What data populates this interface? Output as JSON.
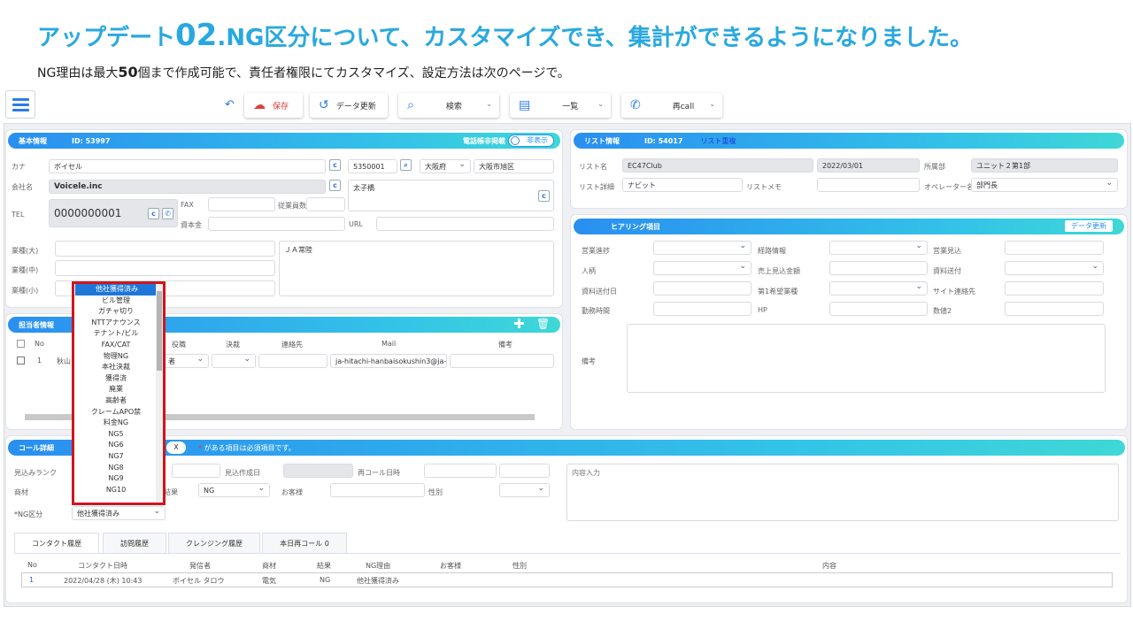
{
  "header": {
    "title_pre": "アップデート",
    "title_num": "02",
    "title_post": ".NG区分について、カスタマイズでき、集計ができるようになりました。",
    "sub_pre": "NG理由は最大",
    "sub_num": "50",
    "sub_post": "個まで作成可能で、責任者権限にてカスタマイズ、設定方法は次のページで。"
  },
  "toolbar": {
    "save": "保存",
    "refresh": "データ更新",
    "search": "検索",
    "list": "一覧",
    "recall": "再call"
  },
  "basic": {
    "title": "基本情報",
    "id": "ID: 53997",
    "phonebook": "電話帳非掲載",
    "toggle": "非表示",
    "kana_label": "カナ",
    "kana": "ボイセル",
    "zip": "5350001",
    "pref": "大阪府",
    "city": "大阪市旭区",
    "company_label": "会社名",
    "company": "Voicele.inc",
    "address2": "太子橋",
    "tel_label": "TEL",
    "tel": "0000000001",
    "fax_label": "FAX",
    "employees_label": "従業員数",
    "capital_label": "資本金",
    "url_label": "URL",
    "industry_l": "業種(大)",
    "industry_m": "業種(中)",
    "industry_s": "業種(小)",
    "note": "ＪＡ常陸"
  },
  "contact": {
    "title": "担当者情報",
    "cols": [
      "No",
      "役職",
      "決裁",
      "連絡先",
      "Mail",
      "備考"
    ],
    "row_no": "1",
    "row_name": "秋山",
    "row_role": "者",
    "row_mail": "ja-hitachi-hanbaisokushin3@ja-"
  },
  "list": {
    "title": "リスト情報",
    "id": "ID: 54017",
    "dup": "リスト重複",
    "name_label": "リスト名",
    "name": "EC47Club",
    "date": "2022/03/01",
    "dept_label": "所属部",
    "dept": "ユニット２第1部",
    "detail_label": "リスト詳細",
    "detail": "ナビット",
    "memo_label": "リストメモ",
    "op_label": "オペレーター名",
    "op": "部門長"
  },
  "hearing": {
    "title": "ヒアリング項目",
    "update": "データ更新",
    "labels": [
      "営業進捗",
      "経路情報",
      "営業見込",
      "人柄",
      "売上見込金額",
      "資料送付",
      "資料送付日",
      "第1希望業種",
      "サイト連絡先",
      "勤務時間",
      "HP",
      "数値2",
      "備考"
    ]
  },
  "call": {
    "title": "コール詳細",
    "x": "X",
    "required_mark": "*",
    "required_note": "がある項目は必須項目です。",
    "rank_label": "見込みランク",
    "created_label": "見込作成日",
    "recall_label": "再コール日時",
    "product_label": "商材",
    "result_label": "結果",
    "result": "NG",
    "customer_label": "お客様",
    "gender_label": "性別",
    "ng_label": "*NG区分",
    "ng_value": "他社獲得済み",
    "content_placeholder": "内容入力"
  },
  "dropdown": {
    "items": [
      "他社獲得済み",
      "ビル管理",
      "ガチャ切り",
      "NTTアナウンス",
      "テナント/ビル",
      "FAX/CAT",
      "物理NG",
      "本社決裁",
      "獲得済",
      "廃業",
      "高齢者",
      "クレームAPO禁",
      "料金NG",
      "NG5",
      "NG6",
      "NG7",
      "NG8",
      "NG9",
      "NG10"
    ]
  },
  "tabs": [
    "コンタクト履歴",
    "訪問履歴",
    "クレンジング履歴",
    "本日再コール 0"
  ],
  "history": {
    "cols": [
      "No",
      "コンタクト日時",
      "発信者",
      "商材",
      "結果",
      "NG理由",
      "お客様",
      "性別",
      "内容"
    ],
    "row": [
      "1",
      "2022/04/28 (木) 10:43",
      "ボイセル タロウ",
      "電気",
      "NG",
      "他社獲得済み",
      "",
      "",
      ""
    ]
  },
  "colors": {
    "accent": "#29a8e0",
    "highlight": "#d0151f"
  }
}
